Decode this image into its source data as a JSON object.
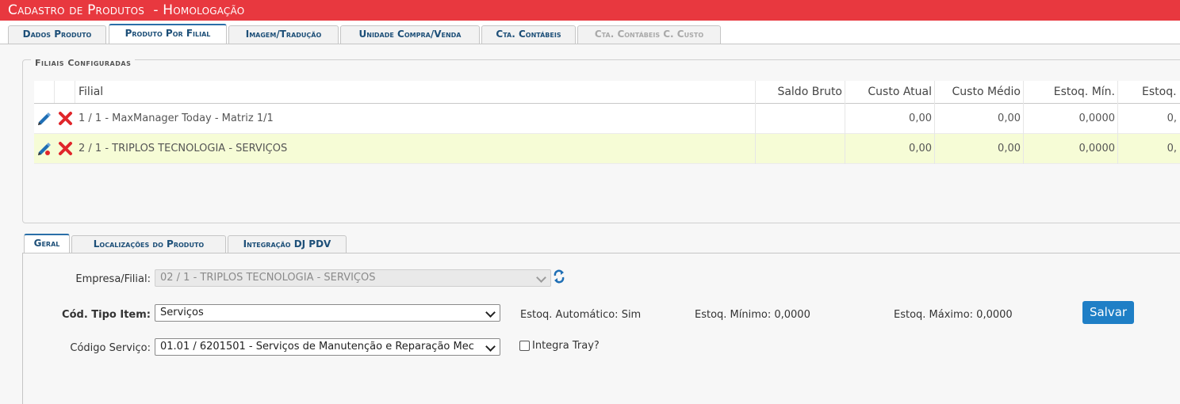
{
  "window": {
    "title": "Cadastro de Produtos",
    "env": "- Homologação",
    "title_color": "#e8383f"
  },
  "tabs": [
    {
      "label": "Dados Produto",
      "state": "normal"
    },
    {
      "label": "Produto Por Filial",
      "state": "active"
    },
    {
      "label": "Imagem/Tradução",
      "state": "normal"
    },
    {
      "label": "Unidade Compra/Venda",
      "state": "normal"
    },
    {
      "label": "Cta. Contábeis",
      "state": "normal"
    },
    {
      "label": "Cta. Contábeis C. Custo",
      "state": "disabled"
    }
  ],
  "filiais": {
    "legend": "Filiais Configuradas",
    "columns": [
      "Filial",
      "Saldo Bruto",
      "Custo Atual",
      "Custo Médio",
      "Estoq. Mín.",
      "Estoq."
    ],
    "rows": [
      {
        "filial": "1 / 1 - MaxManager Today - Matriz 1/1",
        "saldo_bruto": "",
        "custo_atual": "0,00",
        "custo_medio": "0,00",
        "estoq_min": "0,0000",
        "estoq": "0,",
        "selected": false
      },
      {
        "filial": "2 / 1 - TRIPLOS TECNOLOGIA - SERVIÇOS",
        "saldo_bruto": "",
        "custo_atual": "0,00",
        "custo_medio": "0,00",
        "estoq_min": "0,0000",
        "estoq": "0,",
        "selected": true
      }
    ],
    "icons": {
      "edit": "pencil-icon",
      "delete": "red-x-icon"
    }
  },
  "subtabs": [
    {
      "label": "Geral",
      "state": "active"
    },
    {
      "label": "Localizações do Produto",
      "state": "normal"
    },
    {
      "label": "Integração DJ PDV",
      "state": "normal"
    }
  ],
  "form": {
    "empresa_label": "Empresa/Filial:",
    "empresa_value": "02 / 1 - TRIPLOS TECNOLOGIA - SERVIÇOS",
    "refresh_icon": "refresh-icon",
    "tipo_item_label": "Cód. Tipo Item:",
    "tipo_item_value": "Serviços",
    "codigo_servico_label": "Código Serviço:",
    "codigo_servico_value": "01.01 / 6201501 - Serviços de Manutenção e Reparação Mec",
    "estoq_auto": "Estoq. Automático: Sim",
    "estoq_min": "Estoq. Mínimo: 0,0000",
    "estoq_max": "Estoq. Máximo: 0,0000",
    "salvar": "Salvar",
    "integra_tray": "Integra Tray?",
    "integra_tray_checked": false
  },
  "colors": {
    "accent": "#1f7fc6",
    "tab_text": "#1d4f78",
    "selected_row": "#f6fcd6",
    "delete_red": "#e0262b",
    "edit_blue": "#1f6fb5"
  }
}
